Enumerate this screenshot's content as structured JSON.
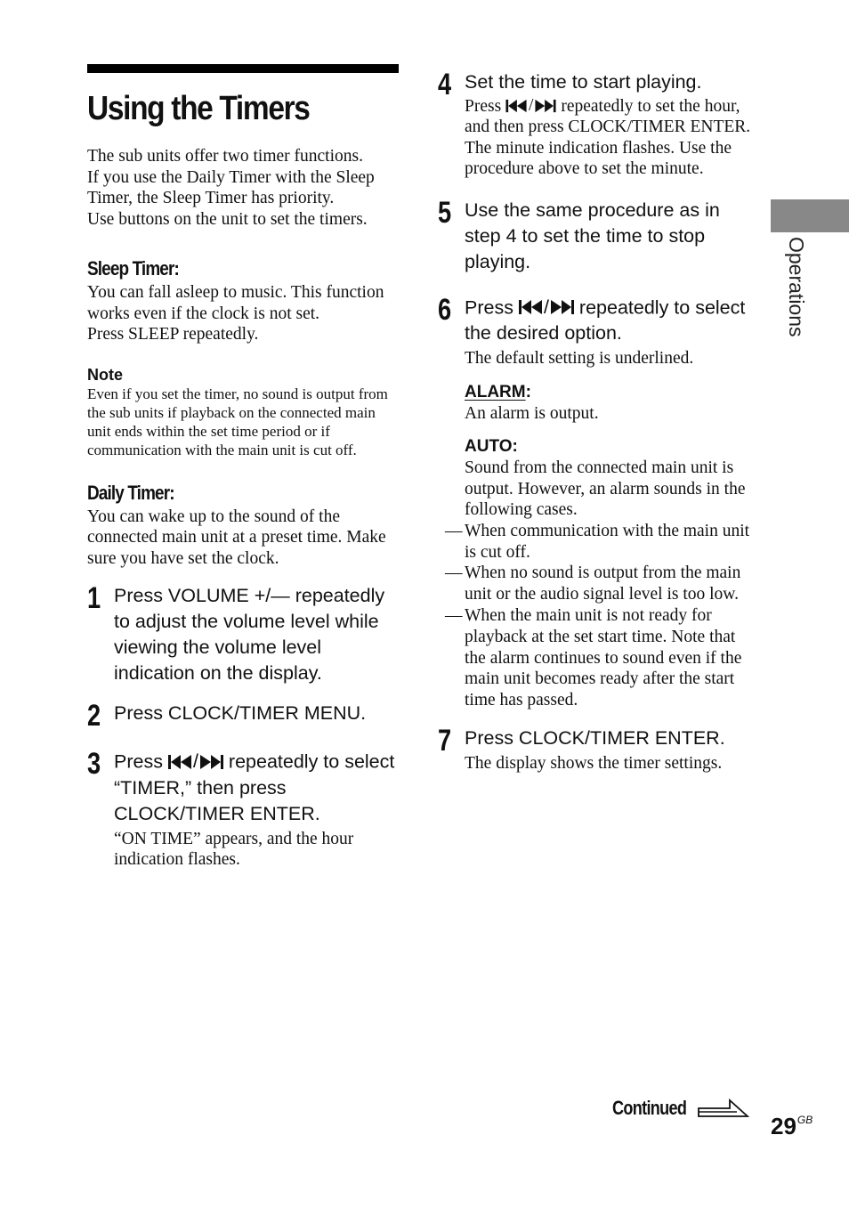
{
  "page": {
    "title": "Using the Timers",
    "intro": [
      "The sub units offer two timer functions.",
      "If you use the Daily Timer with the Sleep Timer, the Sleep Timer has priority.",
      "Use buttons on the unit to set the timers."
    ],
    "side_tab_label": "Operations",
    "continued_label": "Continued",
    "page_number": "29",
    "page_suffix": "GB"
  },
  "sleep_timer": {
    "heading": "Sleep Timer:",
    "text": "You can fall asleep to music. This function works even if the clock is not set.",
    "instruction": "Press SLEEP repeatedly.",
    "note_heading": "Note",
    "note_text": "Even if you set the timer, no sound is output from the sub units if playback on the connected main unit ends within the set time period or if communication with the main unit is cut off."
  },
  "daily_timer": {
    "heading": "Daily Timer:",
    "text": "You can wake up to the sound of the connected main unit at a preset time. Make sure you have set the clock."
  },
  "icons": {
    "prev": "previous-track-icon",
    "next": "next-track-icon",
    "separator": "/"
  },
  "steps": [
    {
      "num": "1",
      "main": "Press VOLUME +/— repeatedly to adjust the volume level while viewing the volume level indication on the display."
    },
    {
      "num": "2",
      "main": "Press CLOCK/TIMER MENU."
    },
    {
      "num": "3",
      "main_pre": "Press",
      "main_post": "repeatedly to select “TIMER,” then press CLOCK/TIMER ENTER.",
      "sub": "“ON TIME” appears, and the hour indication flashes."
    },
    {
      "num": "4",
      "main": "Set the time to start playing.",
      "sub_pre": "Press",
      "sub_post": "repeatedly to set the hour, and then press CLOCK/TIMER ENTER.",
      "sub2": "The minute indication flashes. Use the procedure above to set the minute."
    },
    {
      "num": "5",
      "main": "Use the same procedure as in step 4 to set the time to stop playing."
    },
    {
      "num": "6",
      "main_pre": "Press",
      "main_post": "repeatedly to select the desired option.",
      "sub": "The default setting is underlined."
    },
    {
      "num": "7",
      "main": "Press CLOCK/TIMER ENTER.",
      "sub": "The display shows the timer settings."
    }
  ],
  "options": {
    "alarm": {
      "label": "ALARM",
      "colon": ":",
      "text": "An alarm is output.",
      "default": true
    },
    "auto": {
      "label": "AUTO:",
      "text": "Sound from the connected main unit is output. However, an alarm sounds in the following cases.",
      "bullets": [
        "When communication with the main unit is cut off.",
        "When no sound is output from the main unit or the audio signal level is too low.",
        "When the main unit is not ready for playback at the set start time. Note that the alarm continues to sound even if the main unit becomes ready after the start time has passed."
      ],
      "dash": "—"
    }
  }
}
